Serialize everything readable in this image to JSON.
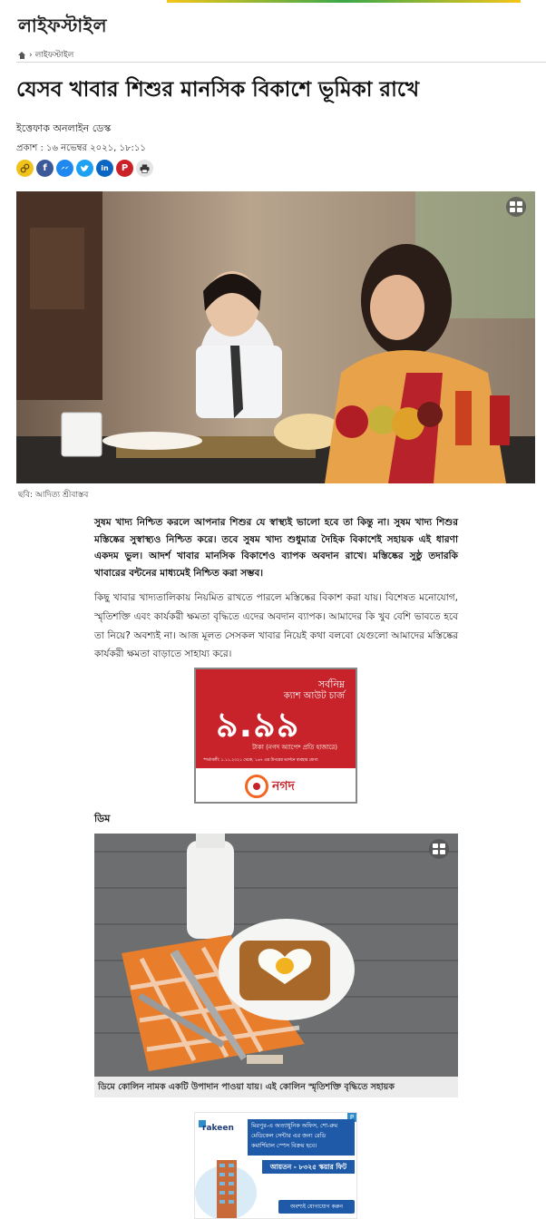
{
  "top_ad": {
    "icon": "ad-banner-strip"
  },
  "section": {
    "title": "লাইফস্টাইল"
  },
  "breadcrumb": {
    "home_icon": "home-icon",
    "separator": "›",
    "current": "লাইফস্টাইল"
  },
  "article": {
    "headline": "যেসব খাবার শিশুর মানসিক বিকাশে ভূমিকা রাখে",
    "author": "ইত্তেফাক অনলাইন ডেস্ক",
    "published": "প্রকাশ : ১৬ নভেম্বর ২০২১, ১৮:১১",
    "share": [
      "link-icon",
      "facebook-icon",
      "messenger-icon",
      "twitter-icon",
      "linkedin-icon",
      "pinterest-icon",
      "print-icon"
    ],
    "hero_caption": "ছবি: আদিত্য শ্রীবাস্তব",
    "lead": "সুষম খাদ্য নিশ্চিত করলে আপনার শিশুর যে স্বাস্থ্যই ভালো হবে তা কিন্তু না। সুষম খাদ্য শিশুর মস্তিষ্কের সুস্বাস্থ্যও নিশ্চিত করে। তবে সুষম খাদ্য শুধুমাত্র দৈহিক বিকাশেই সহায়ক এই ধারণা একদম ভুল। আদর্শ খাবার মানসিক বিকাশেও ব্যাপক অবদান রাখে। মস্তিষ্কের সুষ্ঠু তদারকি খাবারের বন্টনের মাধ্যমেই নিশ্চিত করা সম্ভব।",
    "paragraph1": "কিছু খাবার খাদ্যতালিকায় নিয়মিত রাখতে পারলে মস্তিষ্কের বিকাশ করা যায়। বিশেষত মনোযোগ, স্মৃতিশক্তি এবং কার্যকরী ক্ষমতা বৃদ্ধিতে এদের অবদান ব্যাপক। আমাদের কি খুব বেশি ভাবতে হবে তা নিয়ে? অবশ্যই না। আজ মূলত সেসকল খাবার নিয়েই কথা বলবো যেগুলো আমাদের মস্তিষ্কের কার্যকরী ক্ষমতা বাড়াতে সাহায্য করে।",
    "subheading": "ডিম",
    "egg_caption": "ডিমে কোলিন নামক একটি উপাদান পাওয়া যায়। এই কোলিন স্মৃতিশক্তি বৃদ্ধিতে সহায়ক"
  },
  "ad_nagad": {
    "line1": "সর্বনিম্ন",
    "line2": "ক্যাশ আউট চার্জ",
    "amount": "৯.৯৯",
    "sub": "টাকা (নগদ অ্যাপে* প্রতি হাজারে)",
    "fine": "*শর্তাবলী: ১.১১.২০২১ থেকে, ১৬৭ এর উপরের ভার্সনে ব্যবহার যোগ্য",
    "brand": "নগদ",
    "brand_color": "#c8232b"
  },
  "ad_rakeen": {
    "brand": "rakeen",
    "box_text": "মিরপুর-এ অত্যাধুনিক অফিস, শো-রুম মেডিকেল সেন্টার এর জন্য রেডি কমার্শিয়াল স্পেস বিক্রয় হবে।",
    "size": "আয়তন - ৮৩২৫ স্কয়ার ফিট",
    "cta": "অবশ্যই যোগাযোগ করুন",
    "accent": "#1f5aa8"
  },
  "icons": {
    "gallery": "gallery-icon"
  }
}
